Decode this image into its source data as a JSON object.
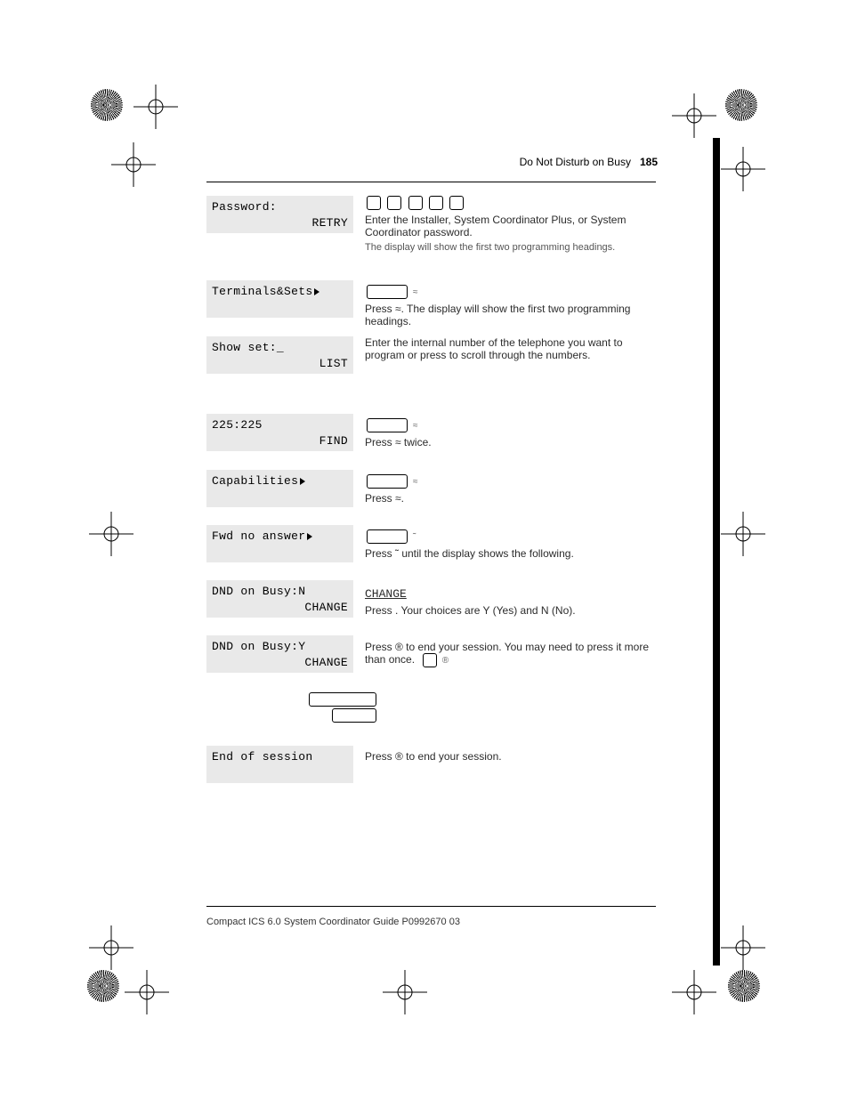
{
  "header": {
    "section": "Do Not Disturb on Busy",
    "page_label": "185"
  },
  "displayDeviceNote": "The display will show the first two programming headings.",
  "screens": [
    {
      "line1": "Password:",
      "line2": "RETRY",
      "hasArrow": false
    },
    {
      "line1": "Terminals&Sets",
      "line2": "",
      "hasArrow": true
    },
    {
      "line1": "Show set:_",
      "line2": "LIST",
      "hasArrow": false
    },
    {
      "line1": "225:225",
      "line2": "FIND",
      "hasArrow": false
    },
    {
      "line1": "Capabilities",
      "line2": "",
      "hasArrow": true
    },
    {
      "line1": "Fwd no answer",
      "line2": "",
      "hasArrow": true
    },
    {
      "line1": "DND on Busy:N",
      "line2": "CHANGE",
      "hasArrow": false
    },
    {
      "line1": "DND on Busy:Y",
      "line2": "CHANGE",
      "hasArrow": false
    },
    {
      "line1": "End of session",
      "line2": "",
      "hasArrow": false
    }
  ],
  "steps": [
    "Enter the Installer, System Coordinator Plus, or System Coordinator password.",
    "Press ≈. The display will show the first two programming headings.",
    "Enter the internal number of the telephone you want to program or press  to scroll through the numbers.",
    "Press ≈ twice.",
    "Press ≈.",
    "Press ˜ until the display shows the following.",
    "Press . Your choices are Y (Yes) and N (No).",
    "Press ® to end your session. You may need to press it more than once.",
    "Press ® to end your session."
  ],
  "buttons": {
    "show": "≈",
    "next": "˜",
    "change": "CHANGE",
    "rls": "®"
  },
  "footer": "Compact ICS 6.0 System Coordinator Guide   P0992670 03"
}
